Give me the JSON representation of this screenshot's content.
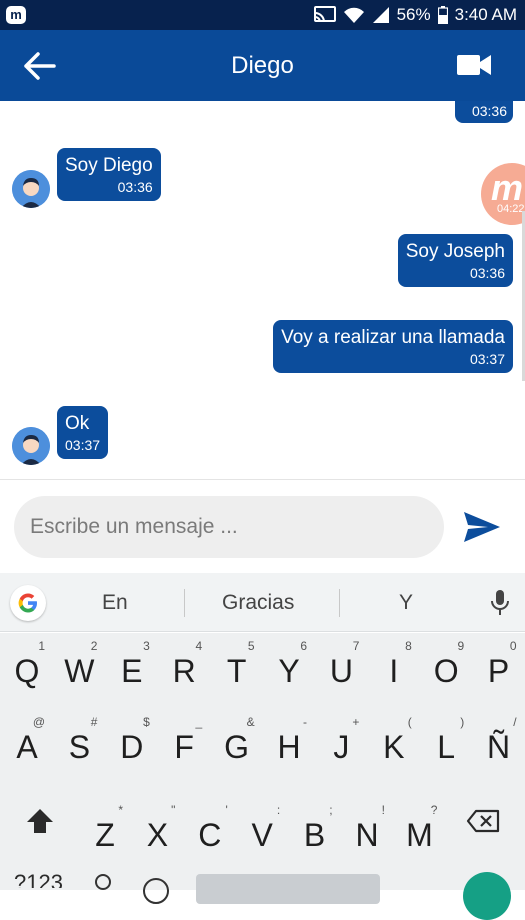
{
  "status_bar": {
    "battery": "56%",
    "time": "3:40 AM"
  },
  "header": {
    "title": "Diego"
  },
  "chat": {
    "partial_time": "03:36",
    "messages": [
      {
        "side": "left",
        "text": "Soy Diego",
        "time": "03:36"
      },
      {
        "side": "right",
        "text": "Soy Joseph",
        "time": "03:36"
      },
      {
        "side": "right",
        "text": "Voy a realizar una llamada",
        "time": "03:37"
      },
      {
        "side": "left",
        "text": "Ok",
        "time": "03:37"
      }
    ],
    "floating_time": "04:22"
  },
  "composer": {
    "placeholder": "Escribe un mensaje ..."
  },
  "keyboard": {
    "suggestions": [
      "En",
      "Gracias",
      "Y"
    ],
    "row1": [
      [
        "Q",
        "1"
      ],
      [
        "W",
        "2"
      ],
      [
        "E",
        "3"
      ],
      [
        "R",
        "4"
      ],
      [
        "T",
        "5"
      ],
      [
        "Y",
        "6"
      ],
      [
        "U",
        "7"
      ],
      [
        "I",
        "8"
      ],
      [
        "O",
        "9"
      ],
      [
        "P",
        "0"
      ]
    ],
    "row2": [
      [
        "A",
        "@"
      ],
      [
        "S",
        "#"
      ],
      [
        "D",
        "$"
      ],
      [
        "F",
        "_"
      ],
      [
        "G",
        "&"
      ],
      [
        "H",
        "-"
      ],
      [
        "J",
        "+"
      ],
      [
        "K",
        "("
      ],
      [
        "L",
        ")"
      ],
      [
        "Ñ",
        "/"
      ]
    ],
    "row3": [
      [
        "Z",
        "*"
      ],
      [
        "X",
        "\""
      ],
      [
        "C",
        "'"
      ],
      [
        "V",
        ":"
      ],
      [
        "B",
        ";"
      ],
      [
        "N",
        "!"
      ],
      [
        "M",
        "?"
      ]
    ],
    "bottom_partial": "?123"
  },
  "colors": {
    "status_bar": "#07224e",
    "app_bar": "#0a4a98",
    "bubble": "#0c4d9c",
    "accent_fab": "#f6a48c"
  }
}
